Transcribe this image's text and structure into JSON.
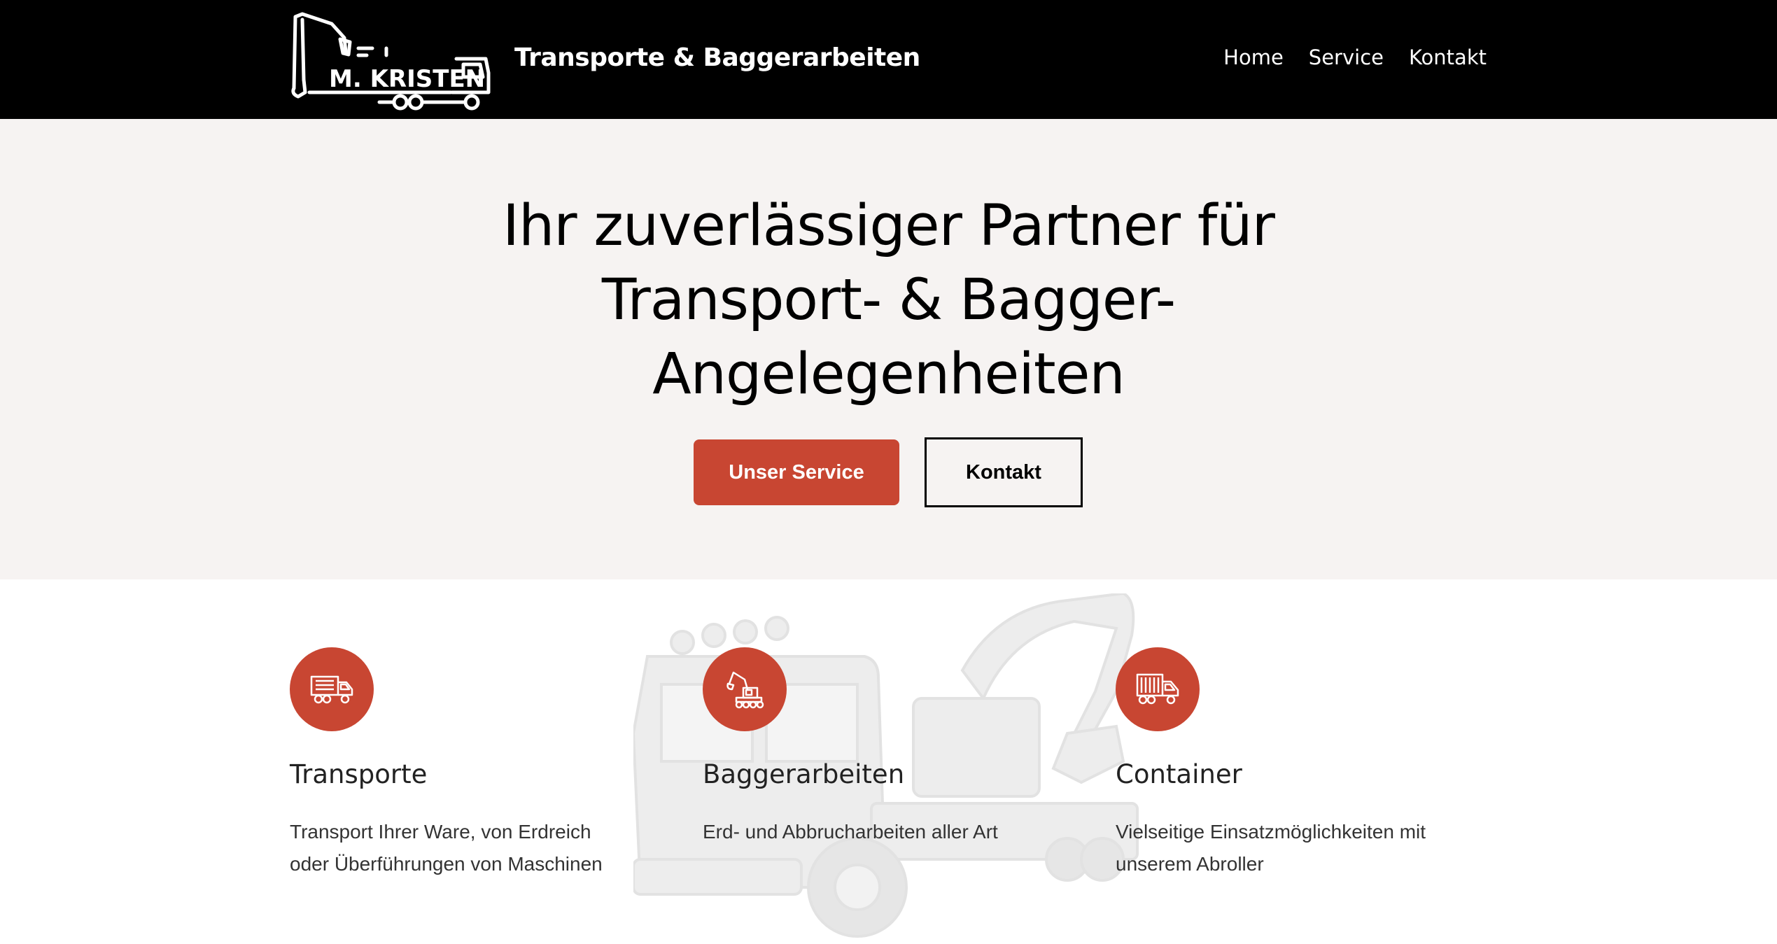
{
  "header": {
    "logo_text": "M. KRISTEN",
    "tagline": "Transporte & Baggerarbeiten",
    "nav": [
      {
        "label": "Home"
      },
      {
        "label": "Service"
      },
      {
        "label": "Kontakt"
      }
    ]
  },
  "hero": {
    "title_lines": [
      "Ihr zuverlässiger Partner für",
      "Transport- & Bagger-",
      "Angelegenheiten"
    ],
    "primary_button": "Unser Service",
    "secondary_button": "Kontakt"
  },
  "services": [
    {
      "icon": "truck-icon",
      "title": "Transporte",
      "text": "Transport Ihrer Ware, von Erdreich oder Überführungen von Maschinen"
    },
    {
      "icon": "excavator-icon",
      "title": "Baggerarbeiten",
      "text": "Erd- und Abbrucharbeiten aller Art"
    },
    {
      "icon": "container-truck-icon",
      "title": "Container",
      "text": "Vielseitige Einsatzmöglichkeiten mit unserem Abroller"
    }
  ],
  "colors": {
    "accent": "#c84632",
    "header_bg": "#000000",
    "hero_bg": "#f6f3f2"
  }
}
